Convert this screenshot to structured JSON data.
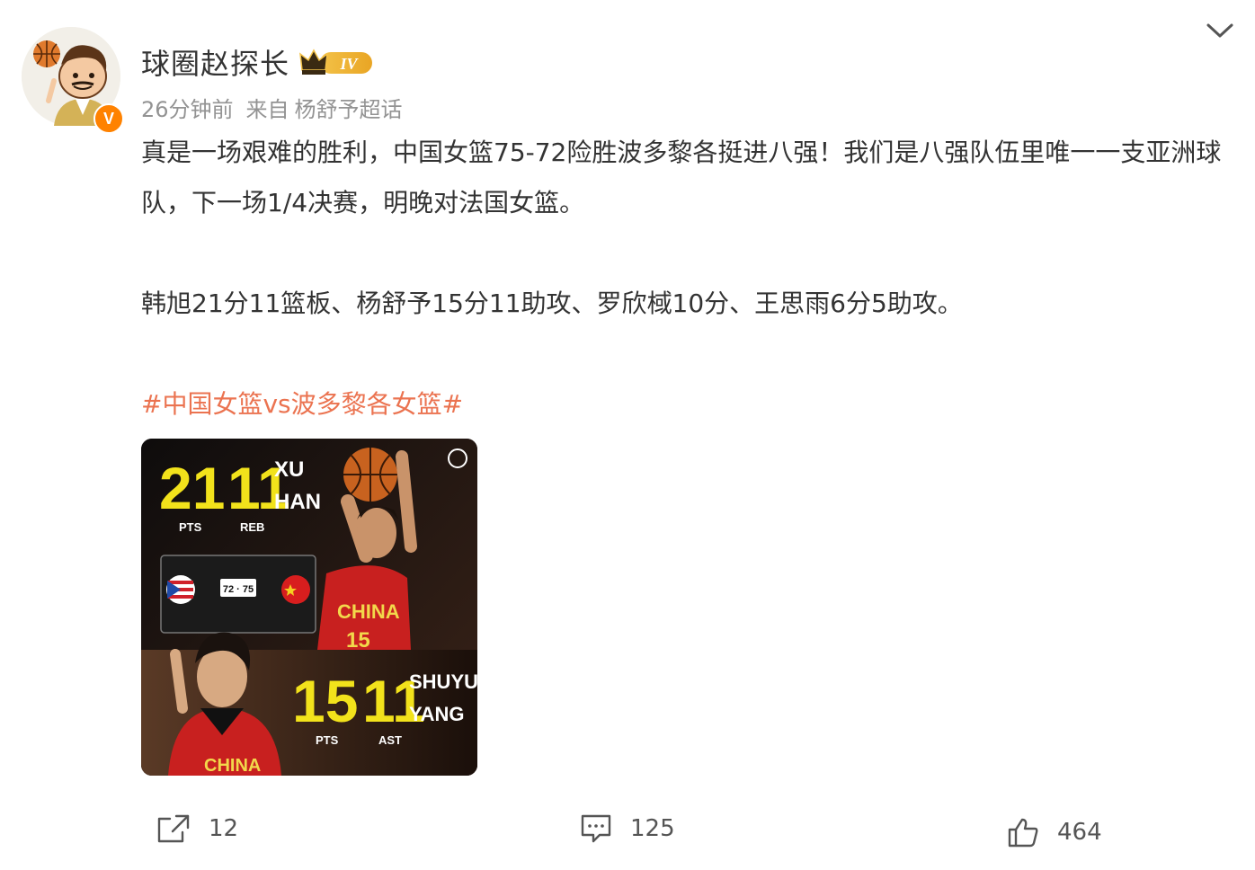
{
  "user": {
    "name": "球圈赵探长",
    "level_badge": "IV",
    "verified_mark": "V",
    "time": "26分钟前",
    "source_prefix": "来自",
    "source": "杨舒予超话"
  },
  "post": {
    "paragraph1": "真是一场艰难的胜利，中国女篮75-72险胜波多黎各挺进八强！我们是八强队伍里唯一一支亚洲球队，下一场1/4决赛，明晚对法国女篮。",
    "paragraph2": "韩旭21分11篮板、杨舒予15分11助攻、罗欣棫10分、王思雨6分5助攻。",
    "hashtag": "#中国女篮vs波多黎各女篮#"
  },
  "image": {
    "top_stat1": "21",
    "top_stat1_label": "PTS",
    "top_stat2": "11",
    "top_stat2_label": "REB",
    "top_name_line1": "XU",
    "top_name_line2": "HAN",
    "score": "72 · 75",
    "jersey_text": "CHINA",
    "jersey_number": "15",
    "bottom_stat1": "15",
    "bottom_stat1_label": "PTS",
    "bottom_stat2": "11",
    "bottom_stat2_label": "AST",
    "bottom_name_line1": "SHUYU",
    "bottom_name_line2": "YANG",
    "bottom_jersey_text": "CHINA"
  },
  "actions": {
    "share_count": "12",
    "comment_count": "125",
    "like_count": "464"
  },
  "icons": [
    "basketball-icon",
    "verified-icon",
    "crown-icon",
    "chevron-down-icon",
    "share-icon",
    "comment-icon",
    "like-icon"
  ],
  "colors": {
    "hashtag": "#eb7350",
    "verified": "#ff8200",
    "stat_yellow": "#f2e21b",
    "meta_gray": "#939393"
  }
}
